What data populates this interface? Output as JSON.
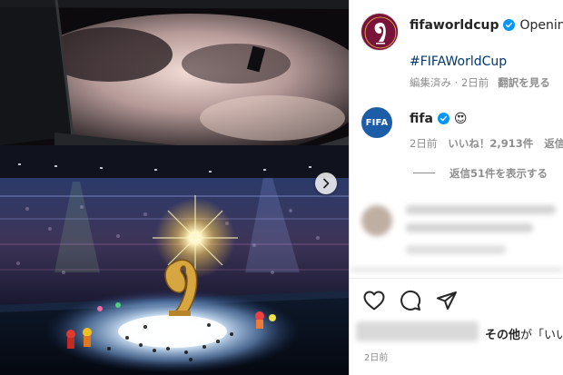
{
  "post": {
    "username": "fifaworldcup",
    "caption_start": "Opening c",
    "hashtag": "#FIFAWorldCup",
    "edited_label": "編集済み · 2日前",
    "translate_label": "翻訳を見る"
  },
  "comment": {
    "username": "fifa",
    "emoji": "😍",
    "time": "2日前",
    "likes": "いいね！2,913件",
    "reply": "返信",
    "view_replies": "返信51件を表示する"
  },
  "avatar_text": {
    "fifa": "FIFA"
  },
  "footer": {
    "likes_suffix_bold": "その他",
    "likes_suffix": "が「いい",
    "timestamp": "2日前"
  },
  "icons": [
    "heart-icon",
    "comment-icon",
    "share-icon",
    "verified-badge-icon",
    "chevron-right-icon"
  ],
  "colors": {
    "verified": "#0095f6",
    "hashtag": "#00376b",
    "wc_avatar": "#7a1339",
    "fifa_avatar": "#1d5da8"
  }
}
